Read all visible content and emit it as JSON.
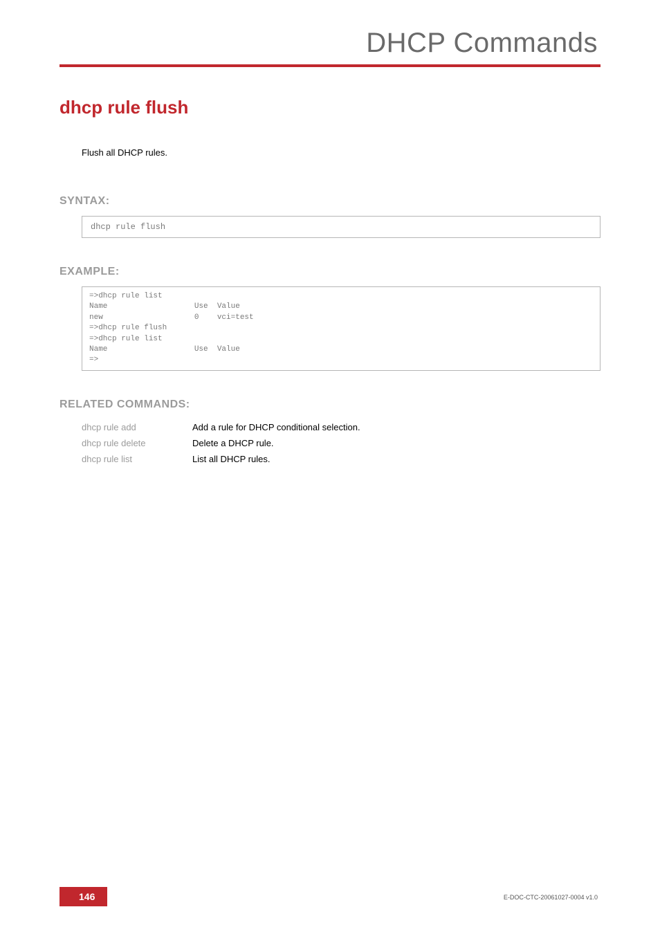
{
  "header": {
    "title": "DHCP Commands"
  },
  "command": {
    "name": "dhcp rule flush",
    "description": "Flush all DHCP rules."
  },
  "syntax": {
    "head": "SYNTAX:",
    "code": "dhcp rule flush"
  },
  "example": {
    "head": "EXAMPLE:",
    "code": "=>dhcp rule list\nName                   Use  Value\nnew                    0    vci=test\n=>dhcp rule flush\n=>dhcp rule list\nName                   Use  Value\n=>"
  },
  "related": {
    "head": "RELATED COMMANDS:",
    "items": [
      {
        "cmd": "dhcp rule add",
        "desc": "Add a rule for DHCP conditional selection."
      },
      {
        "cmd": "dhcp rule delete",
        "desc": "Delete a DHCP rule."
      },
      {
        "cmd": "dhcp rule list",
        "desc": "List all DHCP rules."
      }
    ]
  },
  "footer": {
    "page": "146",
    "doc": "E-DOC-CTC-20061027-0004 v1.0"
  }
}
